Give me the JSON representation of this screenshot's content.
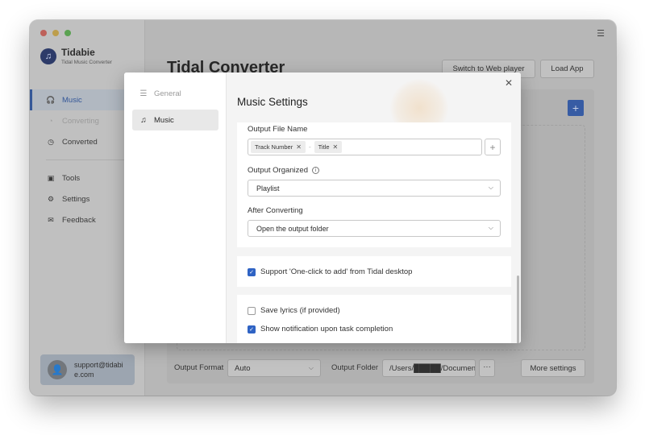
{
  "app": {
    "brand_name": "Tidabie",
    "brand_subtitle": "Tidal Music Converter",
    "title": "Tidal Converter",
    "menu_icon": "hamburger-menu-icon"
  },
  "sidebar": {
    "items": [
      {
        "label": "Music",
        "icon": "headphones-icon",
        "state": "active"
      },
      {
        "label": "Converting",
        "icon": "converting-icon",
        "state": "disabled"
      },
      {
        "label": "Converted",
        "icon": "clock-icon",
        "state": "normal"
      },
      {
        "label": "Tools",
        "icon": "toolbox-icon",
        "state": "normal"
      },
      {
        "label": "Settings",
        "icon": "gear-icon",
        "state": "normal"
      },
      {
        "label": "Feedback",
        "icon": "mail-icon",
        "state": "normal"
      }
    ],
    "support_email": "support@tidabie.com"
  },
  "header": {
    "switch_label": "Switch to Web player",
    "load_label": "Load App"
  },
  "bottom": {
    "format_label": "Output Format",
    "format_value": "Auto",
    "folder_label": "Output Folder",
    "folder_value": "/Users/█████/Documents",
    "dots_label": "···",
    "more_label": "More settings"
  },
  "modal": {
    "title": "Music Settings",
    "nav": [
      {
        "label": "General",
        "icon": "sliders-icon"
      },
      {
        "label": "Music",
        "icon": "music-note-icon"
      }
    ],
    "output_file_name_label": "Output File Name",
    "file_name_tags": [
      "Track Number",
      "Title"
    ],
    "tag_separator": "-",
    "output_organized_label": "Output Organized",
    "output_organized_value": "Playlist",
    "after_converting_label": "After Converting",
    "after_converting_value": "Open the output folder",
    "one_click_label": "Support 'One-click to add' from Tidal desktop",
    "one_click_checked": true,
    "save_lyrics_label": "Save lyrics (if provided)",
    "save_lyrics_checked": false,
    "notification_label": "Show notification upon task completion",
    "notification_checked": true
  },
  "colors": {
    "accent": "#2f63c4",
    "active_nav": "#274f99"
  }
}
